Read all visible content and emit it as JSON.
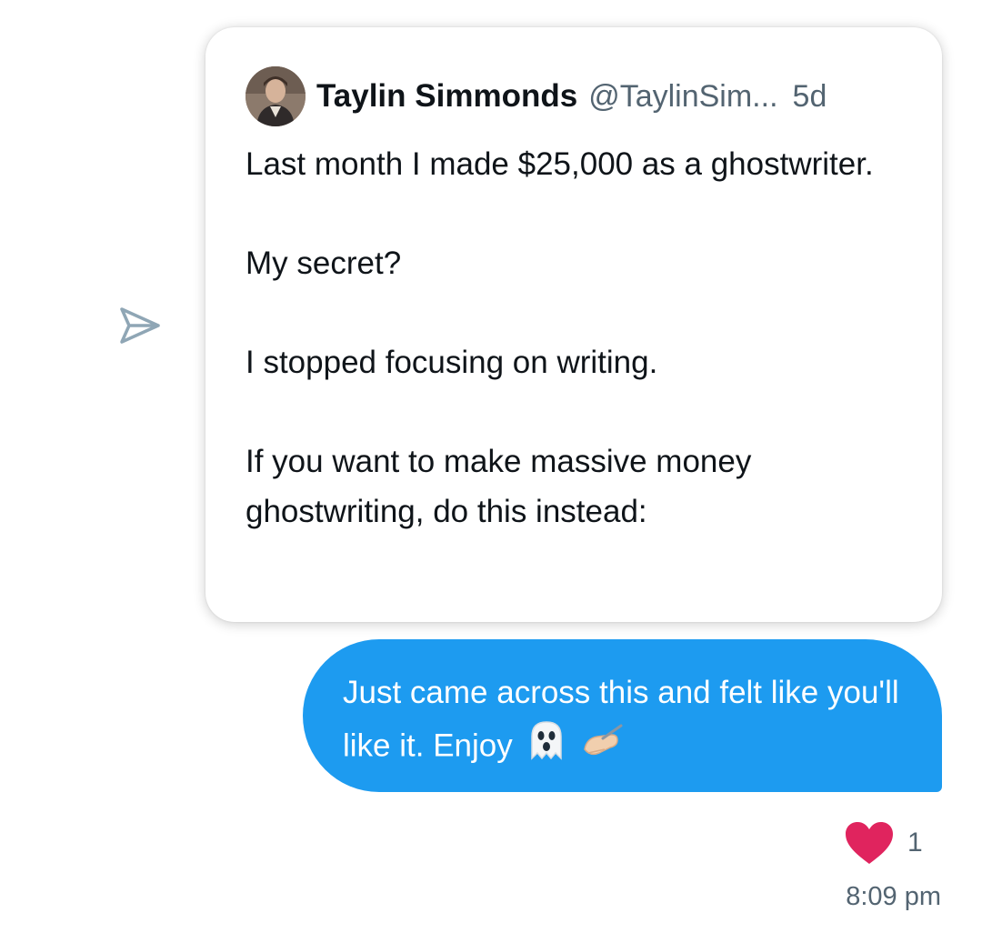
{
  "shared_tweet": {
    "author_name": "Taylin Simmonds",
    "author_handle": "@TaylinSim...",
    "age": "5d",
    "paragraphs": [
      "Last month I made $25,000 as a ghostwriter.",
      "My secret?",
      "I stopped focusing on writing.",
      "If you want to make massive money ghostwriting, do this instead:"
    ]
  },
  "share_icon": "paper-plane-outline-icon",
  "message": {
    "text": "Just came across this and felt like you'll like it. Enjoy",
    "emojis": [
      "👻",
      "✍🏼"
    ],
    "bubble_color": "#1d9bf0"
  },
  "reaction": {
    "icon": "heart-icon",
    "color": "#e0245e",
    "count": "1"
  },
  "timestamp": "8:09 pm",
  "colors": {
    "primary_text": "#0f1419",
    "secondary_text": "#536471",
    "accent": "#1d9bf0"
  }
}
